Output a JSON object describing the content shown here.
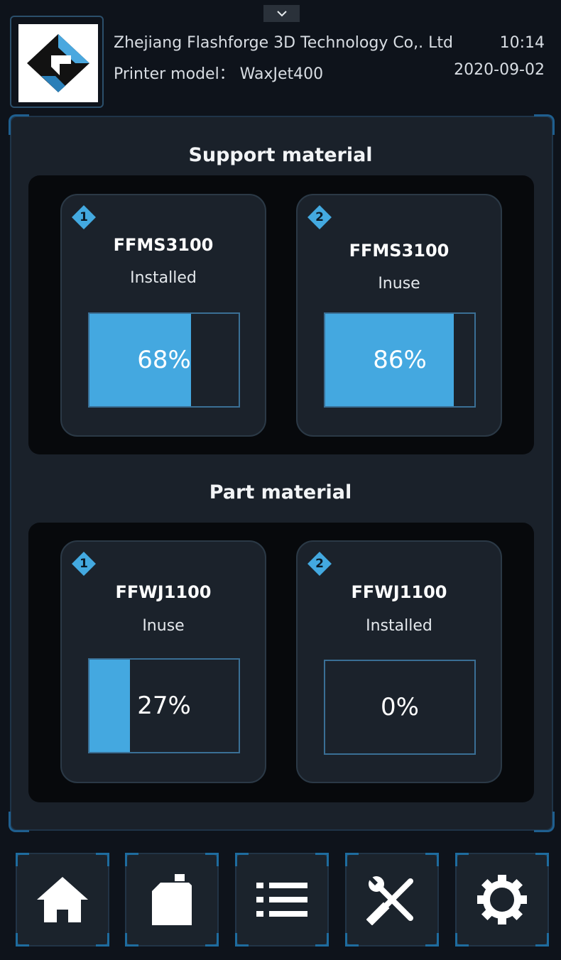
{
  "header": {
    "company": "Zhejiang Flashforge 3D Technology Co,. Ltd",
    "model": "Printer model： WaxJet400",
    "time": "10:14",
    "date": "2020-09-02",
    "logo_icon": "flashforge-logo-icon",
    "pulldown_icon": "chevron-down-icon"
  },
  "colors": {
    "accent": "#44a8e0",
    "background": "#0e131b",
    "card": "#1b222b"
  },
  "support": {
    "title": "Support material",
    "slots": [
      {
        "number": "1",
        "name": "FFMS3100",
        "status": "Installed",
        "level_text": "68%",
        "level": 0.68
      },
      {
        "number": "2",
        "name": "FFMS3100",
        "status": "Inuse",
        "level_text": "86%",
        "level": 0.86
      }
    ]
  },
  "part": {
    "title": "Part material",
    "slots": [
      {
        "number": "1",
        "name": "FFWJ1100",
        "status": "Inuse",
        "level_text": "27%",
        "level": 0.27
      },
      {
        "number": "2",
        "name": "FFWJ1100",
        "status": "Installed",
        "level_text": "0%",
        "level": 0.0
      }
    ]
  },
  "nav": [
    {
      "icon": "home-icon"
    },
    {
      "icon": "material-bottle-icon"
    },
    {
      "icon": "list-icon"
    },
    {
      "icon": "tools-icon"
    },
    {
      "icon": "gear-icon"
    }
  ]
}
